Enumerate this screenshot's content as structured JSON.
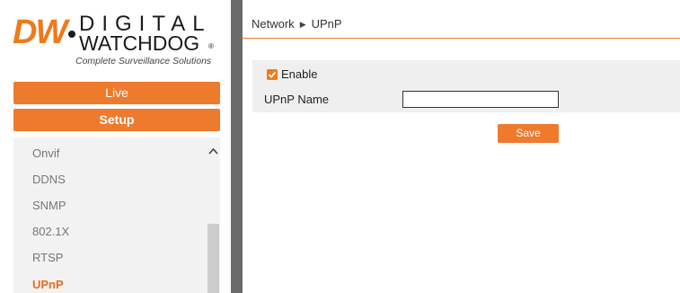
{
  "logo": {
    "mark": "DW",
    "line1": "DIGITAL",
    "line2": "WATCHDOG",
    "registered": "®",
    "tagline": "Complete Surveillance Solutions"
  },
  "nav": {
    "live_label": "Live",
    "setup_label": "Setup"
  },
  "menu": {
    "items": [
      {
        "label": "Onvif",
        "active": false
      },
      {
        "label": "DDNS",
        "active": false
      },
      {
        "label": "SNMP",
        "active": false
      },
      {
        "label": "802.1X",
        "active": false
      },
      {
        "label": "RTSP",
        "active": false
      },
      {
        "label": "UPnP",
        "active": true
      }
    ]
  },
  "breadcrumb": {
    "parent": "Network",
    "separator": "▶",
    "current": "UPnP"
  },
  "form": {
    "enable_label": "Enable",
    "enable_checked": true,
    "name_label": "UPnP Name",
    "name_value": "",
    "save_label": "Save"
  },
  "colors": {
    "accent": "#ee7a2e",
    "divider": "#6b6b6b",
    "panel": "#efefef"
  }
}
